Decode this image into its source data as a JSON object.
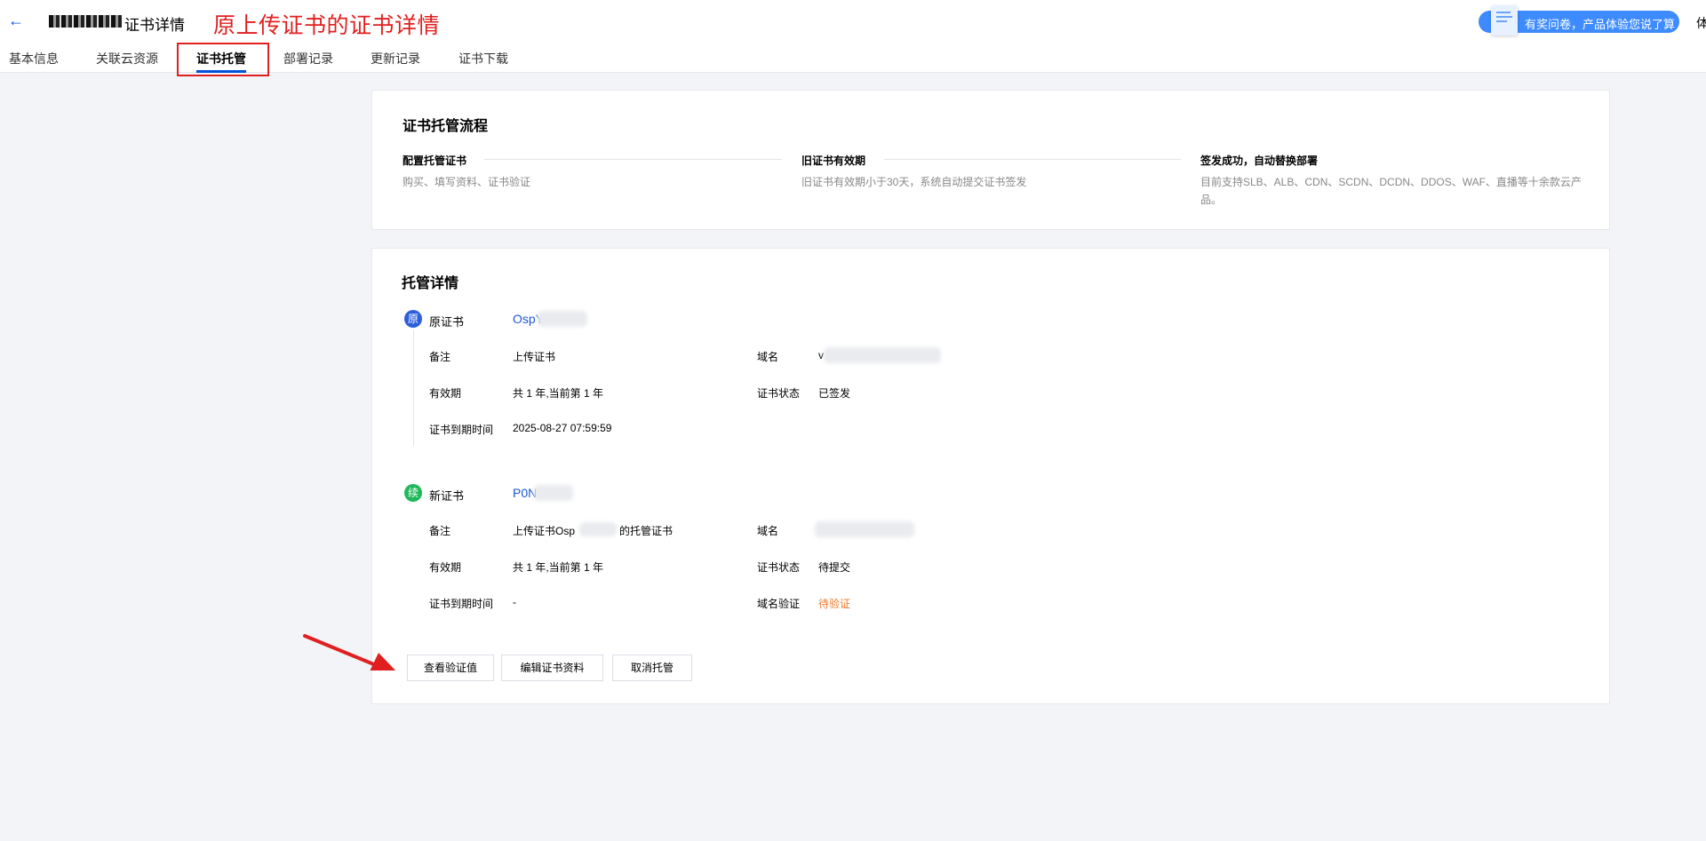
{
  "header": {
    "back_icon": "←",
    "title": "证书详情",
    "annotation_title": "原上传证书的证书详情",
    "survey_text": "有奖问卷，产品体验您说了算",
    "corner_text": "体"
  },
  "tabs": [
    "基本信息",
    "关联云资源",
    "证书托管",
    "部署记录",
    "更新记录",
    "证书下载"
  ],
  "active_tab": "证书托管",
  "flow": {
    "title": "证书托管流程",
    "steps": [
      {
        "title": "配置托管证书",
        "desc": "购买、填写资料、证书验证"
      },
      {
        "title": "旧证书有效期",
        "desc": "旧证书有效期小于30天，系统自动提交证书签发"
      },
      {
        "title": "签发成功，自动替换部署",
        "desc": "目前支持SLB、ALB、CDN、SCDN、DCDN、DDOS、WAF、直播等十余款云产品。"
      }
    ]
  },
  "details": {
    "title": "托管详情",
    "original": {
      "badge": "原",
      "label": "原证书",
      "link": "OspY",
      "remark_label": "备注",
      "remark": "上传证书",
      "validity_label": "有效期",
      "validity": "共 1 年,当前第 1 年",
      "expiry_label": "证书到期时间",
      "expiry": "2025-08-27 07:59:59",
      "domain_label": "域名",
      "domain": "v",
      "status_label": "证书状态",
      "status": "已签发"
    },
    "new": {
      "badge": "续",
      "label": "新证书",
      "link": "P0N",
      "remark_label": "备注",
      "remark_prefix": "上传证书Osp",
      "remark_suffix": "的托管证书",
      "validity_label": "有效期",
      "validity": "共 1 年,当前第 1 年",
      "expiry_label": "证书到期时间",
      "expiry": "-",
      "domain_label": "域名",
      "domain": "",
      "status_label": "证书状态",
      "status": "待提交",
      "verify_label": "域名验证",
      "verify": "待验证"
    }
  },
  "buttons": {
    "view_verify": "查看验证值",
    "edit_info": "编辑证书资料",
    "cancel_hosting": "取消托管"
  },
  "colors": {
    "primary": "#0052d9",
    "annotation": "#e02020",
    "pending": "#ed7b2f",
    "link": "#1a56d6"
  }
}
